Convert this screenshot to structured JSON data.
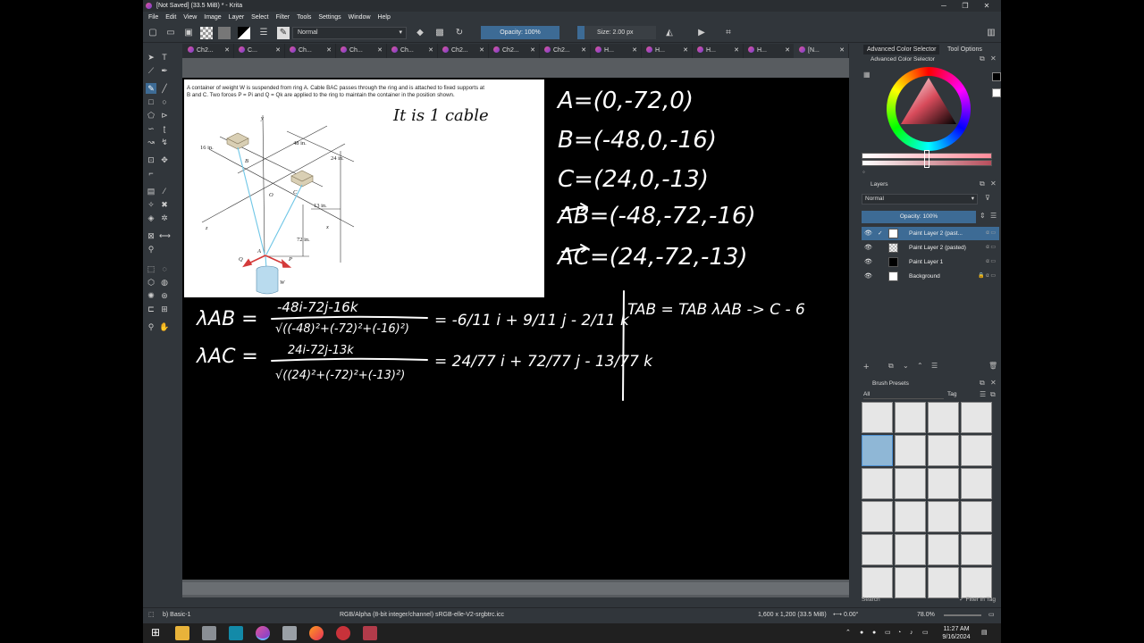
{
  "window": {
    "title": "[Not Saved]  (33.5 MiB) * - Krita"
  },
  "menu": [
    "File",
    "Edit",
    "View",
    "Image",
    "Layer",
    "Select",
    "Filter",
    "Tools",
    "Settings",
    "Window",
    "Help"
  ],
  "toolbar": {
    "blend_mode": "Normal",
    "opacity": "Opacity: 100%",
    "size": "Size: 2.00 px"
  },
  "tabs": [
    "Ch2...",
    "C...",
    "Ch...",
    "Ch...",
    "Ch...",
    "Ch2...",
    "Ch2...",
    "Ch2...",
    "H...",
    "H...",
    "H...",
    "H...",
    "[N..."
  ],
  "problem": {
    "text1": "A container of weight W is suspended from ring A. Cable BAC passes through the ring and is attached to fixed supports at",
    "text2": "B and C. Two forces P = Pi and Q = Qk are applied to the ring to maintain the container in the position shown.",
    "dims": {
      "d16": "16 in.",
      "d48": "48 in.",
      "d24": "24 in.",
      "d13": "13 in.",
      "d72": "72 in."
    },
    "labels": {
      "B": "B",
      "C": "C",
      "O": "O",
      "A": "A",
      "P": "P",
      "Q": "Q",
      "W": "W",
      "x": "x",
      "y": "y",
      "z": "z"
    }
  },
  "handwriting": {
    "note": "It is 1 cable",
    "A": "A=(0,-72,0)",
    "B": "B=(-48,0,-16)",
    "C": "C=(24,0,-13)",
    "AB": "AB=(-48,-72,-16)",
    "AC": "AC=(24,-72,-13)",
    "lamAB_label": "λAB =",
    "lamAB_num": "-48i-72j-16k",
    "lamAB_den": "√((-48)²+(-72)²+(-16)²)",
    "lamAB_res": "= -6/11 i + 9/11 j - 2/11 k",
    "lamAC_label": "λAC =",
    "lamAC_num": "24i-72j-13k",
    "lamAC_den": "√((24)²+(-72)²+(-13)²)",
    "lamAC_res": "= 24/77 i + 72/77 j - 13/77 k",
    "TAB": "TAB = TAB λAB -> C - 6"
  },
  "dock": {
    "tab_color": "Advanced Color Selector",
    "tab_tools": "Tool Options",
    "color_title": "Advanced Color Selector",
    "layers_title": "Layers",
    "layers_blend": "Normal",
    "layers_opacity": "Opacity:  100%",
    "layers": [
      "Paint Layer 2 (past...",
      "Paint Layer 2 (pasted)",
      "Paint Layer 1",
      "Background"
    ],
    "brush_title": "Brush Presets",
    "brush_filter": "All",
    "brush_tag": "Tag",
    "search": "Search",
    "filter_in_tag": "Filter in Tag"
  },
  "status": {
    "brush": "b) Basic-1",
    "colorspace": "RGB/Alpha (8-bit integer/channel)  sRGB-elle-V2-srgbtrc.icc",
    "dims": "1,600 x 1,200 (33.5 MiB)",
    "rotation": "0.00°",
    "zoom": "78.0%"
  },
  "tray": {
    "time": "11:27 AM",
    "date": "9/16/2024"
  },
  "colors": {
    "accent": "#3d6b95",
    "bg": "#31363b",
    "cable": "#6ec6e6",
    "force": "#d43a3a"
  }
}
